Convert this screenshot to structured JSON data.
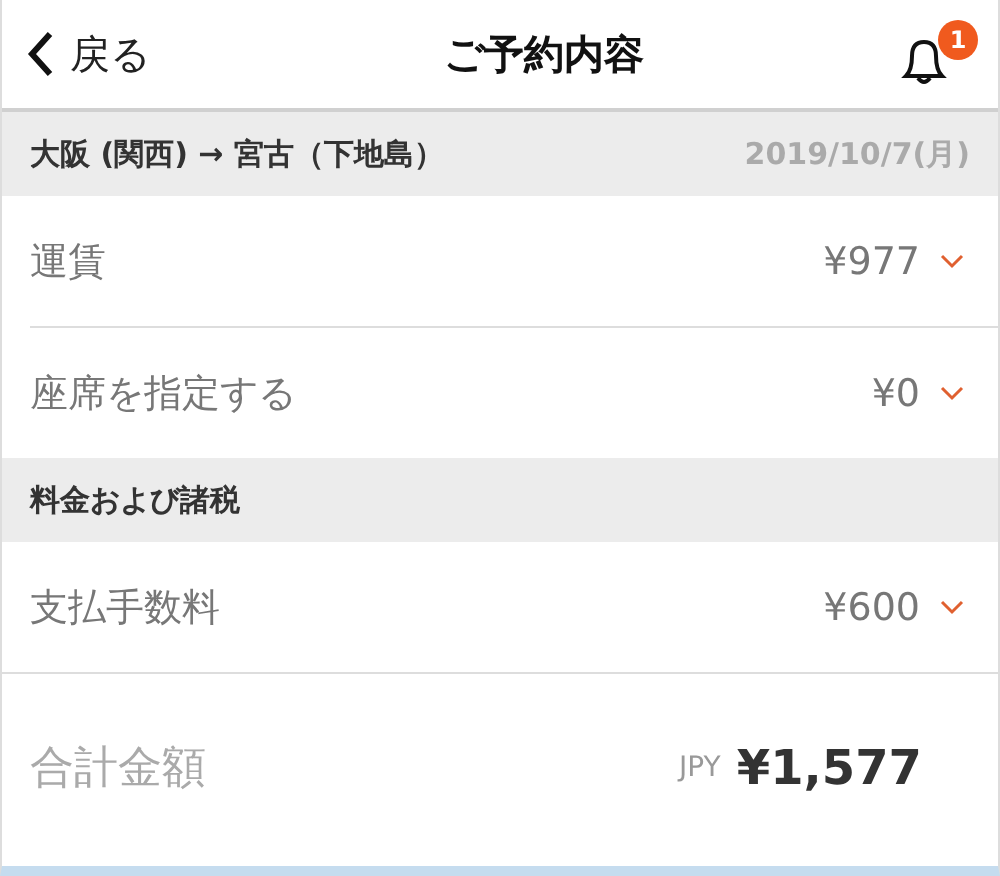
{
  "header": {
    "back_label": "戻る",
    "title": "ご予約内容",
    "notification_count": "1"
  },
  "sections": [
    {
      "title": "大阪 (関西) → 宮古（下地島）",
      "date": "2019/10/7(月)",
      "rows": [
        {
          "label": "運賃",
          "amount": "¥977"
        },
        {
          "label": "座席を指定する",
          "amount": "¥0"
        }
      ]
    },
    {
      "title": "料金および諸税",
      "rows": [
        {
          "label": "支払手数料",
          "amount": "¥600"
        }
      ]
    }
  ],
  "total": {
    "label": "合計金額",
    "currency": "JPY",
    "amount": "¥1,577"
  }
}
